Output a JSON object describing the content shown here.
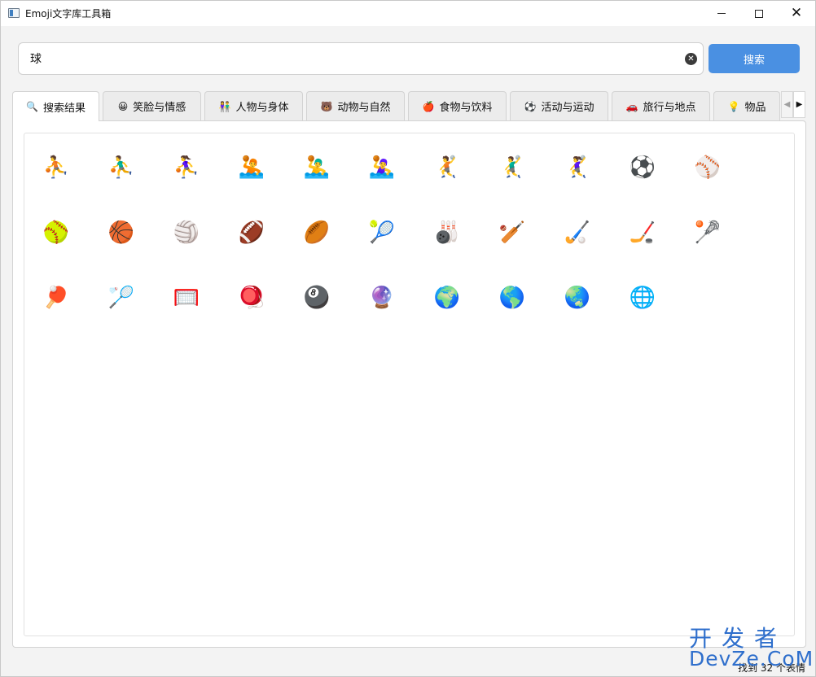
{
  "window": {
    "title": "Emoji文字库工具箱"
  },
  "search": {
    "value": "球",
    "button_label": "搜索"
  },
  "tabs": [
    {
      "icon": "🔍",
      "label": "搜索结果",
      "active": true
    },
    {
      "icon": "😀",
      "label": "笑脸与情感"
    },
    {
      "icon": "👫",
      "label": "人物与身体"
    },
    {
      "icon": "🐻",
      "label": "动物与自然"
    },
    {
      "icon": "🍎",
      "label": "食物与饮料"
    },
    {
      "icon": "⚽",
      "label": "活动与运动"
    },
    {
      "icon": "🚗",
      "label": "旅行与地点"
    },
    {
      "icon": "💡",
      "label": "物品"
    }
  ],
  "emojis": [
    "⛹️",
    "⛹️‍♂️",
    "⛹️‍♀️",
    "🤽",
    "🤽‍♂️",
    "🤽‍♀️",
    "🤾",
    "🤾‍♂️",
    "🤾‍♀️",
    "⚽",
    "⚾",
    "🥎",
    "🏀",
    "🏐",
    "🏈",
    "🏉",
    "🎾",
    "🎳",
    "🏏",
    "🏑",
    "🏒",
    "🥍",
    "🏓",
    "🏸",
    "🥅",
    "🪀",
    "🎱",
    "🔮",
    "🌍",
    "🌎",
    "🌏",
    "🌐"
  ],
  "status": {
    "text": "找到 32 个表情"
  },
  "watermark": {
    "top": "开发者",
    "bottom": "DevZe.CoM"
  }
}
